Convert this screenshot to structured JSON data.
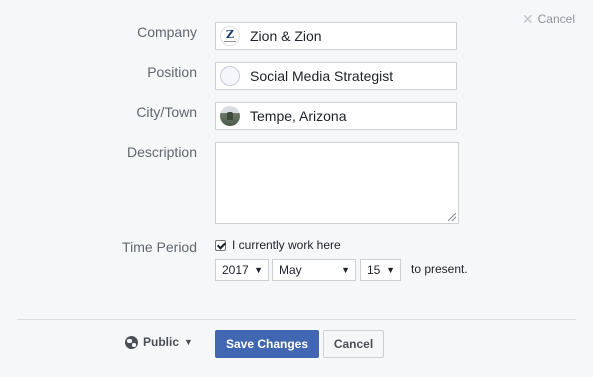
{
  "header": {
    "cancel_label": "Cancel",
    "cancel_icon": "close-icon"
  },
  "form": {
    "company": {
      "label": "Company",
      "value": "Zion & Zion",
      "icon": "company-logo-icon"
    },
    "position": {
      "label": "Position",
      "value": "Social Media Strategist",
      "icon": "position-icon"
    },
    "city": {
      "label": "City/Town",
      "value": "Tempe, Arizona",
      "icon": "city-photo-icon"
    },
    "description": {
      "label": "Description",
      "value": ""
    },
    "time_period": {
      "label": "Time Period",
      "currently_work_label": "I currently work here",
      "currently_work_checked": true,
      "year": "2017",
      "month": "May",
      "day": "15",
      "to_present": "to present."
    }
  },
  "footer": {
    "privacy_label": "Public",
    "privacy_icon": "globe-icon",
    "save_label": "Save Changes",
    "cancel_label": "Cancel"
  },
  "colors": {
    "primary_button": "#4267b2",
    "background": "#f6f7f9"
  }
}
